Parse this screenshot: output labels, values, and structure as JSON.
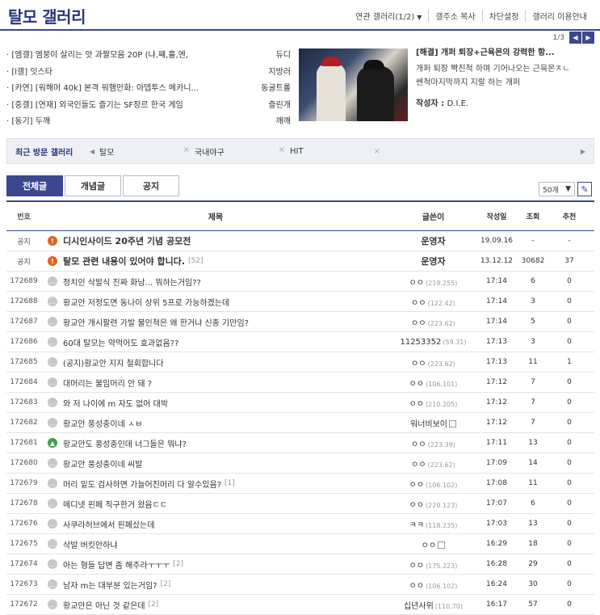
{
  "header": {
    "title": "탈모 갤러리",
    "menu": [
      "연관 갤러리(1/2)",
      "갤주소 복사",
      "차단설정",
      "갤러리 이용안내"
    ]
  },
  "pager": {
    "page": "1/3"
  },
  "hot_list": [
    {
      "title": "· [엠갤] 엠붕이 살리는 앗 과짤모음 20P (냐,쨰,흘,엔,",
      "author": "듀디"
    },
    {
      "title": "· [l갤] 잇스타",
      "author": "지방러"
    },
    {
      "title": "· [카연] [워해머 40k] 본격 워햄만화: 아뎁투스 메카니...",
      "author": "동굴트롤"
    },
    {
      "title": "· [중갤] [연재] 외국인들도 즐기는 SF장르 한국 게임",
      "author": "즐린개"
    },
    {
      "title": "· [동기] 두깨",
      "author": "깨깨"
    }
  ],
  "feature": {
    "title": "[해결] 개퍼 퇴장+근육몬의 강력한 항...",
    "body": [
      "개퍼 퇴장 빡친척 하며 기어나오는 근육몬ㅈㄴ",
      "쎈척마지막까지 지랄 하는 개퍼"
    ],
    "author_label": "작성자 : ",
    "author": "D.I.E."
  },
  "recent": {
    "label": "최근 방문 갤러리",
    "galleries": [
      "탈모",
      "국내야구",
      "HIT"
    ]
  },
  "tabs": [
    "전체글",
    "개념글",
    "공지"
  ],
  "page_size": "50개",
  "columns": [
    "번호",
    "제목",
    "글쓴이",
    "작성일",
    "조회",
    "추천"
  ],
  "rows": [
    {
      "no": "공지",
      "icon": "notice",
      "title": "디시인사이드 20주년 기념 공모전",
      "comments": "",
      "writer": "운영자",
      "ip": "",
      "date": "19.09.16",
      "views": "-",
      "rec": "-",
      "notice": true
    },
    {
      "no": "공지",
      "icon": "notice",
      "title": "탈모 관련 내용이 있어야 합니다.",
      "comments": "[52]",
      "writer": "운영자",
      "ip": "",
      "date": "13.12.12",
      "views": "30682",
      "rec": "37",
      "notice": true
    },
    {
      "no": "172689",
      "icon": "speech",
      "title": "정치인 삭발식 진짜 화남... 뭐하는거임??",
      "comments": "",
      "writer": "ㅇㅇ",
      "ip": "(219.255)",
      "date": "17:14",
      "views": "6",
      "rec": "0"
    },
    {
      "no": "172688",
      "icon": "speech",
      "title": "황교안 저정도면 동나이 상위 5프로 가능하겠는데",
      "comments": "",
      "writer": "ㅇㅇ",
      "ip": "(122.42)",
      "date": "17:14",
      "views": "3",
      "rec": "0"
    },
    {
      "no": "172687",
      "icon": "speech",
      "title": "황교안 개시팔련 가발 불인척은 왜 한거냐 신종 기만임?",
      "comments": "",
      "writer": "ㅇㅇ",
      "ip": "(223.62)",
      "date": "17:14",
      "views": "5",
      "rec": "0"
    },
    {
      "no": "172686",
      "icon": "speech",
      "title": "60대 탈모는 약먹어도 효과없음??",
      "comments": "",
      "writer": "11253352",
      "ip": "(59.31)",
      "date": "17:13",
      "views": "3",
      "rec": "0"
    },
    {
      "no": "172685",
      "icon": "speech",
      "title": "(공지)황교안 지지 철회합니다",
      "comments": "",
      "writer": "ㅇㅇ",
      "ip": "(223.62)",
      "date": "17:13",
      "views": "11",
      "rec": "1"
    },
    {
      "no": "172684",
      "icon": "speech",
      "title": "대머리는 불임머리 안 돼 ?",
      "comments": "",
      "writer": "ㅇㅇ",
      "ip": "(106.101)",
      "date": "17:12",
      "views": "7",
      "rec": "0"
    },
    {
      "no": "172683",
      "icon": "speech",
      "title": "와 저 나이에 m 자도 없어 대박",
      "comments": "",
      "writer": "ㅇㅇ",
      "ip": "(210.205)",
      "date": "17:12",
      "views": "7",
      "rec": "0"
    },
    {
      "no": "172682",
      "icon": "speech",
      "title": "황교안 풍성충이네 ㅅㅂ",
      "comments": "",
      "writer": "워너비보이",
      "ip": "",
      "date": "17:12",
      "views": "7",
      "rec": "0",
      "badge": true
    },
    {
      "no": "172681",
      "icon": "image",
      "title": "황교안도 풍성충인데 너그들은 뭐냐?",
      "comments": "",
      "writer": "ㅇㅇ",
      "ip": "(223.39)",
      "date": "17:11",
      "views": "13",
      "rec": "0"
    },
    {
      "no": "172680",
      "icon": "speech",
      "title": "황교안 풍성충이네 씨발",
      "comments": "",
      "writer": "ㅇㅇ",
      "ip": "(223.62)",
      "date": "17:09",
      "views": "14",
      "rec": "0"
    },
    {
      "no": "172679",
      "icon": "speech",
      "title": "머리 밑도 검사하면 가늘어진머리 다 알수있음?",
      "comments": "[1]",
      "writer": "ㅇㅇ",
      "ip": "(106.102)",
      "date": "17:08",
      "views": "11",
      "rec": "0"
    },
    {
      "no": "172678",
      "icon": "speech",
      "title": "메디넷 핀페 직구한거 왔음ㄷㄷ",
      "comments": "",
      "writer": "ㅇㅇ",
      "ip": "(220.123)",
      "date": "17:07",
      "views": "6",
      "rec": "0"
    },
    {
      "no": "172676",
      "icon": "speech",
      "title": "사쿠라허브에서 핀페샀는데",
      "comments": "",
      "writer": "ㅋㅋ",
      "ip": "(118.235)",
      "date": "17:03",
      "views": "13",
      "rec": "0"
    },
    {
      "no": "172675",
      "icon": "speech",
      "title": "삭발 버킷안하냐",
      "comments": "",
      "writer": "ㅇㅇ",
      "ip": "",
      "date": "16:29",
      "views": "18",
      "rec": "0",
      "badge": true
    },
    {
      "no": "172674",
      "icon": "speech",
      "title": "아는 형들 답변 좀 해주라ㅜㅜㅜ",
      "comments": "[2]",
      "writer": "ㅇㅇ",
      "ip": "(175.223)",
      "date": "16:28",
      "views": "29",
      "rec": "0"
    },
    {
      "no": "172673",
      "icon": "speech",
      "title": "남자 m는 대부분 있는거임?",
      "comments": "[2]",
      "writer": "ㅇㅇ",
      "ip": "(106.102)",
      "date": "16:24",
      "views": "30",
      "rec": "0"
    },
    {
      "no": "172672",
      "icon": "speech",
      "title": "황교안은 아닌 것 같은데",
      "comments": "[2]",
      "writer": "십년사위",
      "ip": "(110.70)",
      "date": "16:17",
      "views": "57",
      "rec": "0"
    }
  ]
}
